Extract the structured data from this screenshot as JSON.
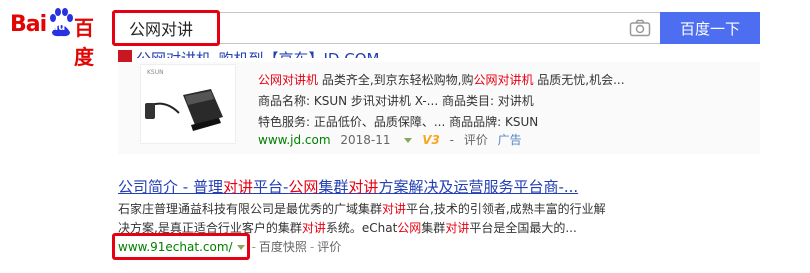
{
  "logo": {
    "bai": "Bai",
    "du": "du",
    "cn": "百度"
  },
  "search": {
    "query": "公网对讲",
    "button_label": "百度一下"
  },
  "result1": {
    "title_visible": "公网对讲机_购机到【京东】JD.COM",
    "line1": {
      "parts": [
        "公网对讲机",
        " 品类齐全,到京东轻松购物,购",
        "公网对讲机",
        " 品质无忧,机会..."
      ]
    },
    "line2": "商品名称:  KSUN 步讯对讲机 X-...  商品类目:  对讲机",
    "line3": "特色服务:  正品低价、品质保障、...  商品品牌:  KSUN",
    "img_brand": "KSUN",
    "meta": {
      "url": "www.jd.com",
      "date": "2018-11",
      "badge": "V3",
      "sep": "-",
      "review": "评价",
      "ad": "广告"
    }
  },
  "result2": {
    "title_parts": [
      "公司简介 - 普理",
      "对讲",
      "平台-",
      "公网",
      "集群",
      "对讲",
      "方案解决及运营服务平台商-..."
    ],
    "abs_line1": [
      "石家庄普理通益科技有限公司是最优秀的广域集群",
      "对讲",
      "平台,技术的引领者,成熟丰富的行业解"
    ],
    "abs_line2": [
      "决方案,是真正适合行业客户的集群",
      "对讲",
      "系统。eChat",
      "公网",
      "集群",
      "对讲",
      "平台是全国最大的..."
    ],
    "meta": {
      "url": "www.91echat.com/",
      "sep1": "-",
      "kuaizhao": "百度快照",
      "sep2": "-",
      "review": "评价"
    }
  },
  "colors": {
    "accent": "#4e6ef2",
    "highlight": "#e60012",
    "link": "#2440b3",
    "url_green": "#008000"
  }
}
